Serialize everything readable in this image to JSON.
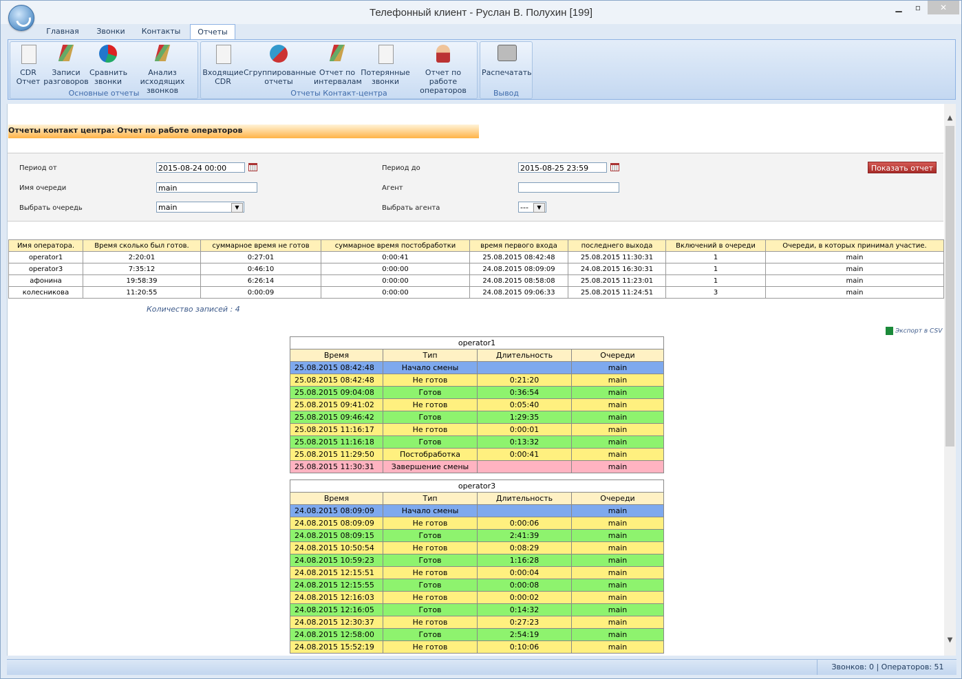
{
  "window": {
    "title": "Телефонный клиент - Руслан В. Полухин [199]"
  },
  "tabs": [
    "Главная",
    "Звонки",
    "Контакты",
    "Отчеты"
  ],
  "ribbon": {
    "groups": [
      {
        "label": "Основные отчеты",
        "buttons": [
          {
            "line1": "CDR",
            "line2": "Отчет",
            "icon": "cdr-report-icon"
          },
          {
            "line1": "Записи",
            "line2": "разговоров",
            "icon": "recordings-icon"
          },
          {
            "line1": "Сравнить",
            "line2": "звонки",
            "icon": "compare-calls-icon"
          },
          {
            "line1": "Анализ исходящих",
            "line2": "звонков",
            "icon": "outgoing-analysis-icon"
          }
        ]
      },
      {
        "label": "Отчеты Контакт-центра",
        "buttons": [
          {
            "line1": "Входящие",
            "line2": "CDR",
            "icon": "incoming-cdr-icon"
          },
          {
            "line1": "Сгруппированные",
            "line2": "отчеты",
            "icon": "grouped-reports-icon"
          },
          {
            "line1": "Отчет по",
            "line2": "интервалам",
            "icon": "interval-report-icon"
          },
          {
            "line1": "Потерянные",
            "line2": "звонки",
            "icon": "lost-calls-icon"
          },
          {
            "line1": "Отчет по работе",
            "line2": "операторов",
            "icon": "operator-report-icon"
          }
        ]
      },
      {
        "label": "Вывод",
        "buttons": [
          {
            "line1": "Распечатать",
            "line2": "",
            "icon": "printer-icon"
          }
        ]
      }
    ]
  },
  "page": {
    "heading": "Отчеты контакт центра: Отчет по работе операторов",
    "filters": {
      "period_from_label": "Период от",
      "period_from": "2015-08-24 00:00",
      "period_to_label": "Период до",
      "period_to": "2015-08-25 23:59",
      "queue_name_label": "Имя очереди",
      "queue_name": "main",
      "agent_label": "Агент",
      "agent": "",
      "select_queue_label": "Выбрать очередь",
      "select_queue": "main",
      "select_agent_label": "Выбрать агента",
      "select_agent": "---",
      "show_button": "Показать отчет"
    },
    "summary": {
      "columns": [
        "Имя оператора.",
        "Время сколько был готов.",
        "суммарное время не готов",
        "суммарное время постобработки",
        "время первого входа",
        "последнего выхода",
        "Включений в очереди",
        "Очереди, в которых принимал участие."
      ],
      "rows": [
        [
          "operator1",
          "2:20:01",
          "0:27:01",
          "0:00:41",
          "25.08.2015 08:42:48",
          "25.08.2015 11:30:31",
          "1",
          "main"
        ],
        [
          "operator3",
          "7:35:12",
          "0:46:10",
          "0:00:00",
          "24.08.2015 08:09:09",
          "24.08.2015 16:30:31",
          "1",
          "main"
        ],
        [
          "афонина",
          "19:58:39",
          "6:26:14",
          "0:00:00",
          "24.08.2015 08:58:08",
          "25.08.2015 11:23:01",
          "1",
          "main"
        ],
        [
          "колесникова",
          "11:20:55",
          "0:00:09",
          "0:00:00",
          "24.08.2015 09:06:33",
          "25.08.2015 11:24:51",
          "3",
          "main"
        ]
      ],
      "count_text": "Количество записей : 4",
      "export_label": "Экспорт в CSV"
    },
    "detail_columns": [
      "Время",
      "Тип",
      "Длительность",
      "Очереди"
    ],
    "details": [
      {
        "operator": "operator1",
        "rows": [
          {
            "time": "25.08.2015 08:42:48",
            "type": "Начало смены",
            "duration": "",
            "queue": "main",
            "color": "blue"
          },
          {
            "time": "25.08.2015 08:42:48",
            "type": "Не готов",
            "duration": "0:21:20",
            "queue": "main",
            "color": "yellow"
          },
          {
            "time": "25.08.2015 09:04:08",
            "type": "Готов",
            "duration": "0:36:54",
            "queue": "main",
            "color": "green"
          },
          {
            "time": "25.08.2015 09:41:02",
            "type": "Не готов",
            "duration": "0:05:40",
            "queue": "main",
            "color": "yellow"
          },
          {
            "time": "25.08.2015 09:46:42",
            "type": "Готов",
            "duration": "1:29:35",
            "queue": "main",
            "color": "green"
          },
          {
            "time": "25.08.2015 11:16:17",
            "type": "Не готов",
            "duration": "0:00:01",
            "queue": "main",
            "color": "yellow"
          },
          {
            "time": "25.08.2015 11:16:18",
            "type": "Готов",
            "duration": "0:13:32",
            "queue": "main",
            "color": "green"
          },
          {
            "time": "25.08.2015 11:29:50",
            "type": "Постобработка",
            "duration": "0:00:41",
            "queue": "main",
            "color": "yellow"
          },
          {
            "time": "25.08.2015 11:30:31",
            "type": "Завершение смены",
            "duration": "",
            "queue": "main",
            "color": "pink"
          }
        ]
      },
      {
        "operator": "operator3",
        "rows": [
          {
            "time": "24.08.2015 08:09:09",
            "type": "Начало смены",
            "duration": "",
            "queue": "main",
            "color": "blue"
          },
          {
            "time": "24.08.2015 08:09:09",
            "type": "Не готов",
            "duration": "0:00:06",
            "queue": "main",
            "color": "yellow"
          },
          {
            "time": "24.08.2015 08:09:15",
            "type": "Готов",
            "duration": "2:41:39",
            "queue": "main",
            "color": "green"
          },
          {
            "time": "24.08.2015 10:50:54",
            "type": "Не готов",
            "duration": "0:08:29",
            "queue": "main",
            "color": "yellow"
          },
          {
            "time": "24.08.2015 10:59:23",
            "type": "Готов",
            "duration": "1:16:28",
            "queue": "main",
            "color": "green"
          },
          {
            "time": "24.08.2015 12:15:51",
            "type": "Не готов",
            "duration": "0:00:04",
            "queue": "main",
            "color": "yellow"
          },
          {
            "time": "24.08.2015 12:15:55",
            "type": "Готов",
            "duration": "0:00:08",
            "queue": "main",
            "color": "green"
          },
          {
            "time": "24.08.2015 12:16:03",
            "type": "Не готов",
            "duration": "0:00:02",
            "queue": "main",
            "color": "yellow"
          },
          {
            "time": "24.08.2015 12:16:05",
            "type": "Готов",
            "duration": "0:14:32",
            "queue": "main",
            "color": "green"
          },
          {
            "time": "24.08.2015 12:30:37",
            "type": "Не готов",
            "duration": "0:27:23",
            "queue": "main",
            "color": "yellow"
          },
          {
            "time": "24.08.2015 12:58:00",
            "type": "Готов",
            "duration": "2:54:19",
            "queue": "main",
            "color": "green"
          },
          {
            "time": "24.08.2015 15:52:19",
            "type": "Не готов",
            "duration": "0:10:06",
            "queue": "main",
            "color": "yellow"
          }
        ]
      }
    ]
  },
  "statusbar": {
    "text": "Звонков: 0 | Операторов: 51"
  },
  "colors": {
    "start": "#7ea9ee",
    "not_ready": "#fff07f",
    "ready": "#8ef36e",
    "end": "#ffb3c1",
    "accent": "#ffb347"
  }
}
